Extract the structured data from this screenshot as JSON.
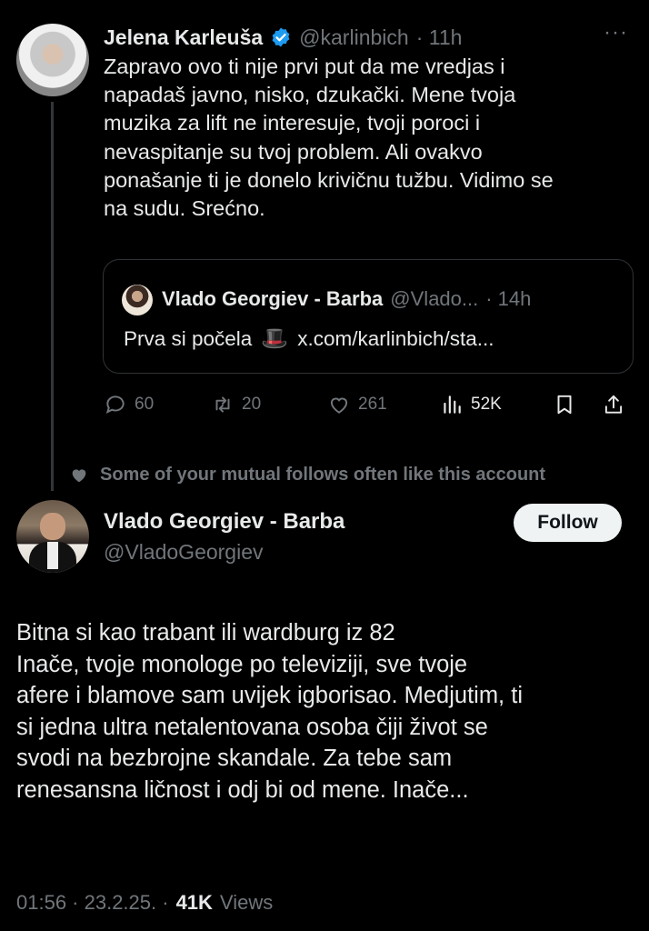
{
  "tweet1": {
    "name": "Jelena Karleuša",
    "handle": "@karlinbich",
    "time": "· 11h",
    "more": "···",
    "body": "Zapravo ovo ti nije prvi put da me vredjas i\nnapadaš javno, nisko, dzukački. Mene tvoja\nmuzika za lift ne interesuje, tvoji poroci i\nnevaspitanje su tvoj problem. Ali ovakvo\nponašanje ti je donelo krivičnu tužbu. Vidimo se\nna sudu. Srećno.",
    "quote": {
      "name": "Vlado Georgiev - Barba",
      "handle": "@Vlado...",
      "time": "· 14h",
      "text": "Prva si počela",
      "emoji": "🎩",
      "link": "x.com/karlinbich/sta..."
    },
    "stats": {
      "replies": "60",
      "reposts": "20",
      "likes": "261",
      "views": "52K"
    }
  },
  "context": "Some of your mutual follows often like this account",
  "tweet2": {
    "name": "Vlado Georgiev - Barba",
    "handle": "@VladoGeorgiev",
    "follow_label": "Follow",
    "body": "Bitna si kao trabant ili wardburg iz 82\nInače, tvoje monologe po televiziji, sve tvoje\nafere i blamove sam uvijek igborisao. Medjutim, ti\nsi jedna ultra netalentovana osoba čiji život se\nsvodi na bezbrojne skandale. Za tebe sam\nrenesansna ličnost i odj  bi od mene. Inače...",
    "time": "01:56 · 23.2.25. ·",
    "views_count": "41K",
    "views_label": "Views"
  },
  "colors": {
    "background": "#000000",
    "text": "#e7e9ea",
    "muted": "#71767b",
    "verified": "#1d9bf0",
    "border": "#2f3336"
  }
}
